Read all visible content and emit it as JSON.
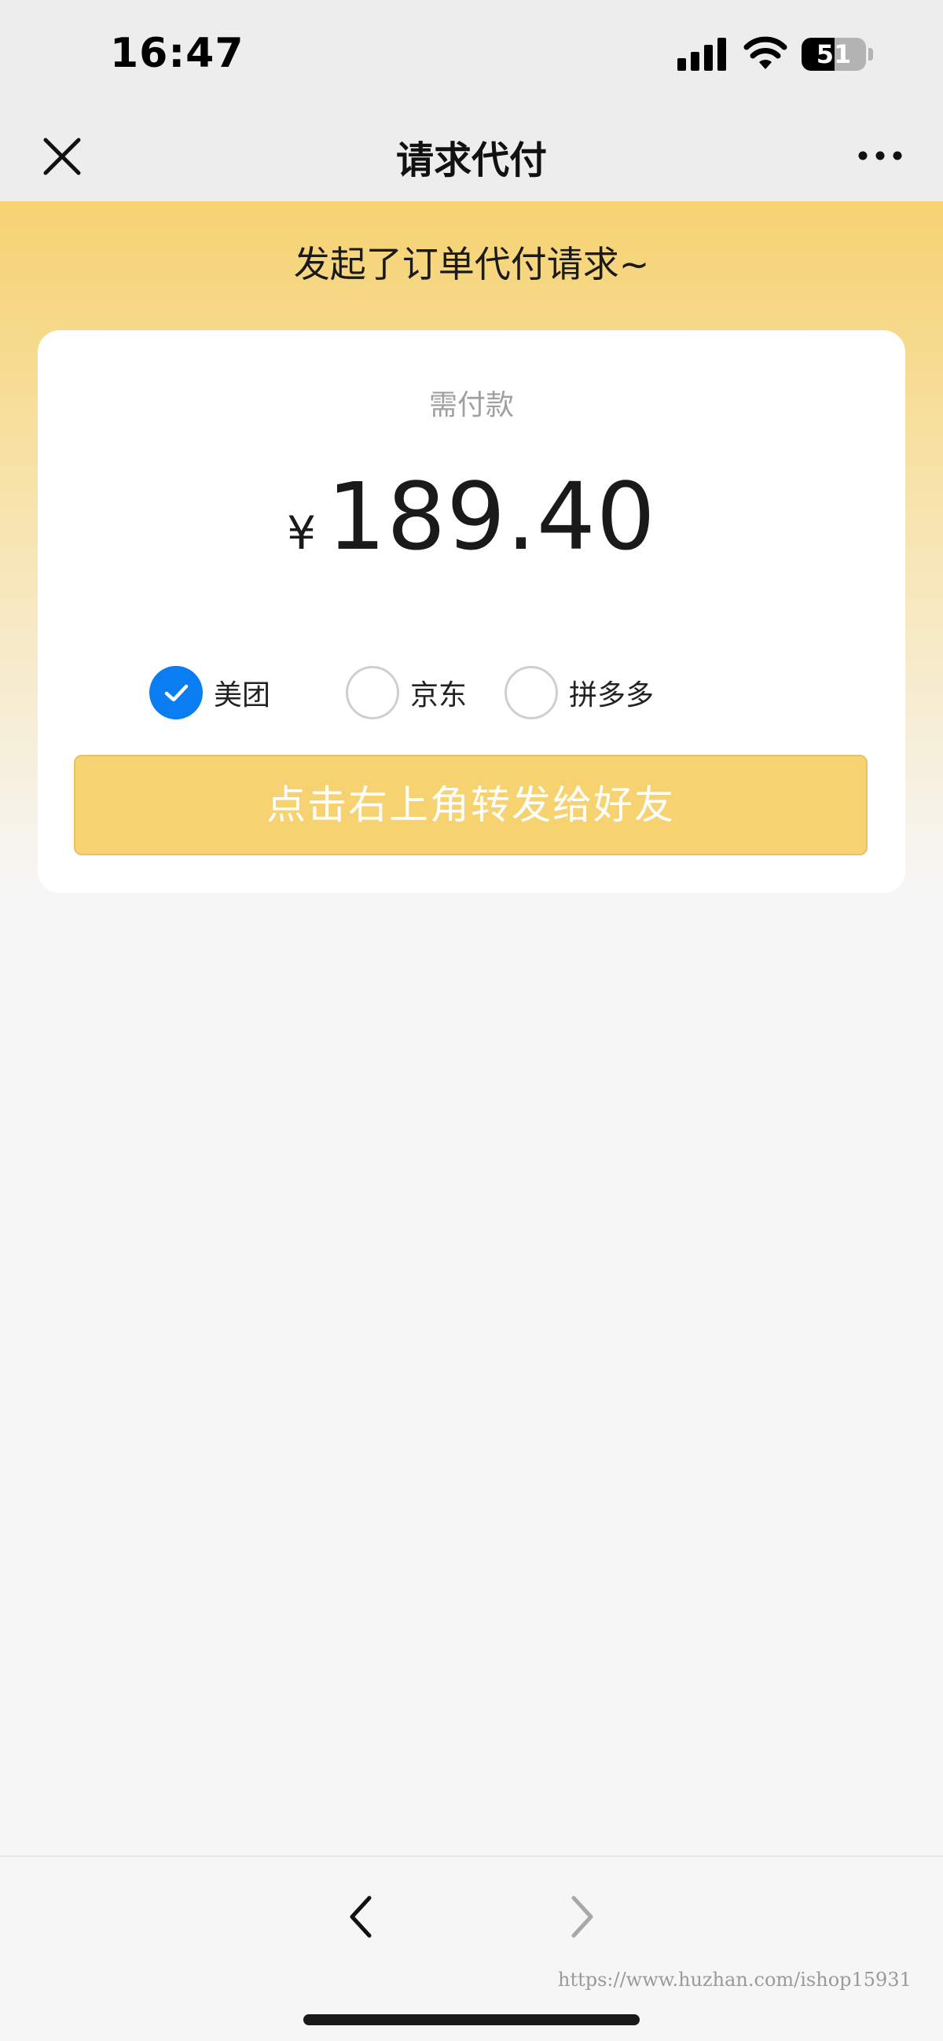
{
  "status_bar": {
    "time": "16:47",
    "battery_level": "51",
    "battery_fraction": 0.51,
    "icons": [
      "signal-icon",
      "wifi-icon",
      "battery-icon"
    ]
  },
  "nav": {
    "title": "请求代付",
    "close_icon": "close-icon",
    "more_icon": "more-icon"
  },
  "hero": {
    "title": "发起了订单代付请求~"
  },
  "card": {
    "pay_label": "需付款",
    "currency": "¥",
    "amount": "189.40",
    "platforms": [
      {
        "label": "美团",
        "checked": true
      },
      {
        "label": "京东",
        "checked": false
      },
      {
        "label": "拼多多",
        "checked": false
      }
    ],
    "share_button": "点击右上角转发给好友"
  },
  "bottom_bar": {
    "back_icon": "chevron-left-icon",
    "forward_icon": "chevron-right-icon",
    "watermark": "https://www.huzhan.com/ishop15931"
  },
  "colors": {
    "accent_yellow": "#f6d271",
    "check_blue": "#0a7df2",
    "nav_bg": "#ededed",
    "page_bg": "#f6f6f6"
  }
}
